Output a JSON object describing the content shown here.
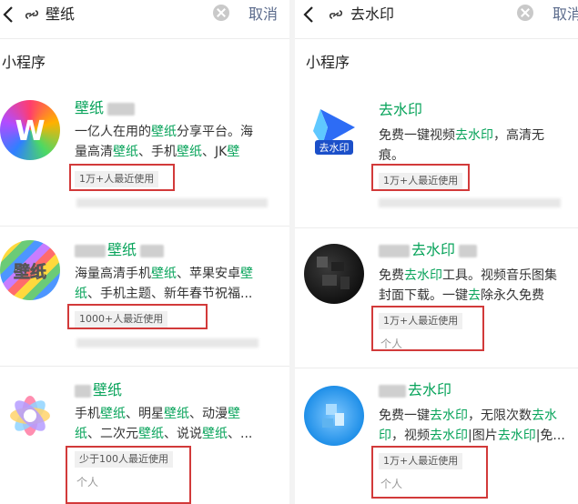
{
  "left": {
    "query": "壁纸",
    "cancel_label": "取消",
    "section_title": "小程序",
    "results": [
      {
        "title_prefix": "",
        "title_highlight": "壁纸",
        "title_suffix": "",
        "desc_line1": [
          "一亿人在用的",
          "壁纸",
          "分享平台。海"
        ],
        "desc_line2": [
          "量高清",
          "壁纸",
          "、手机",
          "壁纸",
          "、JK",
          "壁"
        ],
        "usage": "1万+人最近使用",
        "tag": ""
      },
      {
        "title_prefix": "",
        "title_highlight": "壁纸",
        "title_suffix": "",
        "icon_text": "壁纸",
        "desc_line1": [
          "海量高清手机",
          "壁纸",
          "、苹果安卓",
          "壁"
        ],
        "desc_line2": [
          "纸",
          "、手机主题、新年春节祝福..."
        ],
        "usage": "1000+人最近使用",
        "tag": ""
      },
      {
        "title_prefix": "",
        "title_highlight": "壁纸",
        "title_suffix": "",
        "desc_line1": [
          "手机",
          "壁纸",
          "、明星",
          "壁纸",
          "、动漫",
          "壁"
        ],
        "desc_line2": [
          "纸",
          "、二次元",
          "壁纸",
          "、说说",
          "壁纸",
          "、..."
        ],
        "usage": "少于100人最近使用",
        "tag": "个人"
      }
    ]
  },
  "right": {
    "query": "去水印",
    "cancel_label": "取消",
    "section_title": "小程序",
    "results": [
      {
        "title_highlight": "去水印",
        "icon_text": "去水印",
        "desc_line1": [
          "免费一键视频",
          "去水印",
          "，高清无"
        ],
        "desc_line2": [
          "痕。"
        ],
        "usage": "1万+人最近使用",
        "tag": ""
      },
      {
        "title_highlight": "去水印",
        "desc_line1": [
          "免费",
          "去水印",
          "工具。视频音乐图集"
        ],
        "desc_line2": [
          "封面下载。一键",
          "去",
          "除永久免费"
        ],
        "usage": "1万+人最近使用",
        "tag": "个人"
      },
      {
        "title_highlight": "去水印",
        "desc_line1": [
          "免费一键",
          "去水印",
          "，无限次数",
          "去水"
        ],
        "desc_line2": [
          "印",
          "，视频",
          "去水印",
          "|图片",
          "去水印",
          "|免..."
        ],
        "usage": "1万+人最近使用",
        "tag": "个人"
      }
    ]
  },
  "colors": {
    "highlight": "#07a35a",
    "annotation": "#d23a3a",
    "cancel": "#5b6b8c"
  }
}
